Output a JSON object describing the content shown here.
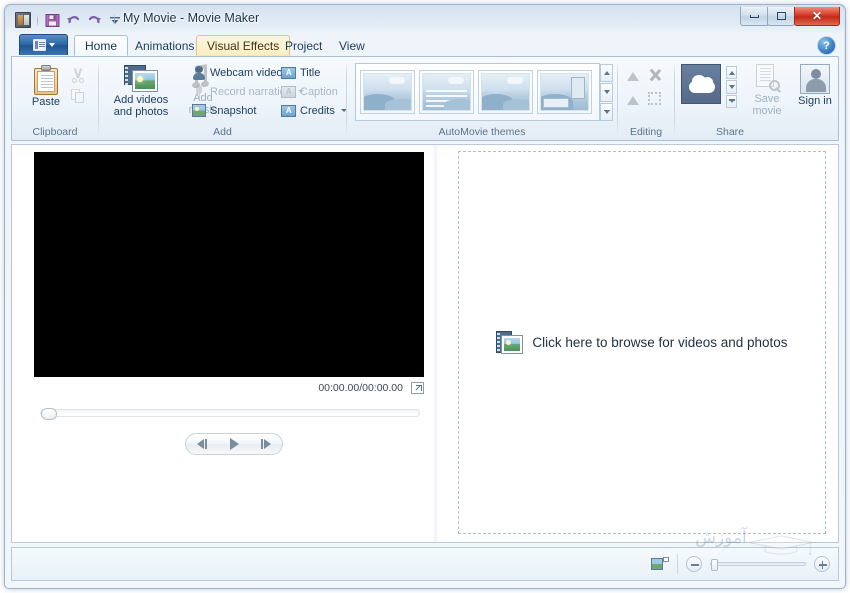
{
  "window": {
    "title": "My Movie - Movie Maker",
    "app_icon": "movie-maker-icon",
    "controls": {
      "minimize": "–",
      "restore": "❐",
      "close": "✕"
    }
  },
  "quick_access": {
    "items": [
      {
        "name": "save",
        "icon": "floppy-disk-icon",
        "label": "Save"
      },
      {
        "name": "undo",
        "icon": "undo-arrow-icon",
        "label": "Undo"
      },
      {
        "name": "redo",
        "icon": "redo-arrow-icon",
        "label": "Redo"
      },
      {
        "name": "customize",
        "icon": "chevron-down-icon",
        "label": "Customize Quick Access Toolbar"
      }
    ]
  },
  "ribbon": {
    "file_tab": {
      "label": "File",
      "icon": "file-menu-icon"
    },
    "help": {
      "label": "?",
      "name": "help-icon"
    },
    "tabs": [
      {
        "label": "Home",
        "state": "active"
      },
      {
        "label": "Animations",
        "state": "normal"
      },
      {
        "label": "Visual Effects",
        "state": "hover"
      },
      {
        "label": "Project",
        "state": "normal"
      },
      {
        "label": "View",
        "state": "normal"
      }
    ],
    "groups": [
      {
        "name": "clipboard",
        "label": "Clipboard",
        "big_buttons": [
          {
            "label": "Paste",
            "icon": "clipboard-icon",
            "enabled": true
          }
        ],
        "small_buttons": [
          {
            "label": "Cut",
            "icon": "scissors-icon",
            "enabled": false
          },
          {
            "label": "Copy",
            "icon": "copy-icon",
            "enabled": false
          }
        ]
      },
      {
        "name": "add",
        "label": "Add",
        "big_buttons": [
          {
            "label": "Add videos and photos",
            "icon": "add-videos-photos-icon",
            "enabled": true
          },
          {
            "label": "Add music",
            "icon": "music-note-icon",
            "enabled": false,
            "has_dropdown": true
          }
        ],
        "small_buttons": [
          {
            "label": "Webcam video",
            "icon": "webcam-icon",
            "enabled": true,
            "has_dropdown": false
          },
          {
            "label": "Record narration",
            "icon": "microphone-icon",
            "enabled": false,
            "has_dropdown": true
          },
          {
            "label": "Snapshot",
            "icon": "snapshot-icon",
            "enabled": true,
            "has_dropdown": false
          },
          {
            "label": "Title",
            "icon": "title-text-icon",
            "enabled": true,
            "has_dropdown": false
          },
          {
            "label": "Caption",
            "icon": "caption-text-icon",
            "enabled": false,
            "has_dropdown": false
          },
          {
            "label": "Credits",
            "icon": "credits-text-icon",
            "enabled": true,
            "has_dropdown": true
          }
        ]
      },
      {
        "name": "automovie-themes",
        "label": "AutoMovie themes",
        "themes": [
          {
            "name": "no-theme",
            "style": "plain"
          },
          {
            "name": "contemporary",
            "style": "lines"
          },
          {
            "name": "cinematic",
            "style": "plain"
          },
          {
            "name": "fade",
            "style": "pip"
          }
        ],
        "scroll": [
          {
            "name": "scroll-up-button",
            "icon": "arrow-up-icon"
          },
          {
            "name": "scroll-down-button",
            "icon": "arrow-down-icon"
          },
          {
            "name": "more-button",
            "icon": "more-arrow-icon"
          }
        ]
      },
      {
        "name": "editing",
        "label": "Editing",
        "small_buttons": [
          {
            "label": "Fade in",
            "icon": "fade-in-icon",
            "enabled": false
          },
          {
            "label": "Remove",
            "icon": "remove-x-icon",
            "enabled": false
          },
          {
            "label": "Fade out",
            "icon": "fade-out-icon",
            "enabled": false
          },
          {
            "label": "Select",
            "icon": "select-crop-icon",
            "enabled": false
          }
        ]
      },
      {
        "name": "share",
        "label": "Share",
        "big_buttons": [
          {
            "label": "OneDrive",
            "icon": "cloud-icon",
            "enabled": true
          },
          {
            "label": "Save movie",
            "icon": "save-movie-icon",
            "enabled": false,
            "has_dropdown": true
          },
          {
            "label": "Sign in",
            "icon": "sign-in-person-icon",
            "enabled": true
          }
        ],
        "scroll": [
          {
            "name": "share-scroll-up",
            "icon": "arrow-up-icon"
          },
          {
            "name": "share-scroll-down",
            "icon": "arrow-down-icon"
          },
          {
            "name": "share-more",
            "icon": "more-arrow-icon"
          }
        ]
      }
    ]
  },
  "preview": {
    "timecode": "00:00.00/00:00.00",
    "fullscreen_label": "View full screen",
    "transport": [
      {
        "name": "previous-frame-button",
        "icon": "previous-frame-icon"
      },
      {
        "name": "play-button",
        "icon": "play-icon"
      },
      {
        "name": "next-frame-button",
        "icon": "next-frame-icon"
      }
    ],
    "seek_position_percent": 0
  },
  "storyboard": {
    "prompt": "Click here to browse for videos and photos",
    "icon": "video-photo-icon"
  },
  "statusbar": {
    "view_icon": "storyboard-view-icon",
    "zoom_out": "–",
    "zoom_in": "+",
    "zoom_level_percent": 0
  },
  "watermark": {
    "text": "آموزش"
  },
  "colors": {
    "accent": "#2f6aa8",
    "close_button": "#c32a16",
    "ribbon_bg": "#eef4fa",
    "hover_tab": "#fbeec2",
    "video_surface": "#000000"
  }
}
